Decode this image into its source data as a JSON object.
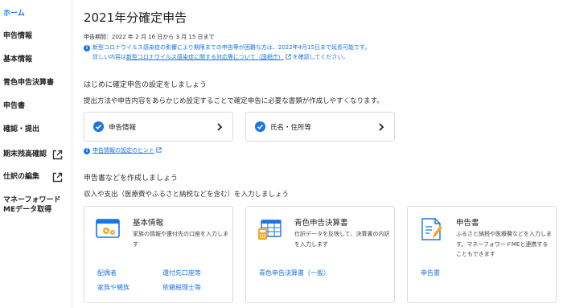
{
  "sidebar": {
    "items": [
      {
        "label": "ホーム",
        "active": true,
        "external": false
      },
      {
        "label": "申告情報",
        "active": false,
        "external": false
      },
      {
        "label": "基本情報",
        "active": false,
        "external": false
      },
      {
        "label": "青色申告決算書",
        "active": false,
        "external": false
      },
      {
        "label": "申告書",
        "active": false,
        "external": false
      },
      {
        "label": "確認・提出",
        "active": false,
        "external": false
      },
      {
        "label": "期末残高確認",
        "active": false,
        "external": true
      },
      {
        "label": "仕訳の編集",
        "active": false,
        "external": true
      },
      {
        "label": "マネーフォワード",
        "active": false,
        "external": false
      },
      {
        "label": "MEデータ取得",
        "active": false,
        "external": false
      }
    ]
  },
  "page": {
    "title": "2021年分確定申告",
    "period": "申告期間：2022 年 2 月 16 日から 3 月 15 日まで",
    "notice_line1": "新型コロナウイルス感染症の影響により期限までの申告等が困難な方は、2022年4月15日まで延長可能です。",
    "notice_line2_pre": "詳しい内容は",
    "notice_link": "新型コロナウイルス感染症に関する対応等について（国税庁）",
    "notice_line2_post": "を確認してください。"
  },
  "setup": {
    "heading": "はじめに確定申告の設定をしましょう",
    "description": "提出方法や申告内容をあらかじめ設定することで確定申告に必要な書類が作成しやすくなります。",
    "cards": [
      {
        "label": "申告情報"
      },
      {
        "label": "氏名・住所等"
      }
    ],
    "hint_link": "申告情報の設定のヒント"
  },
  "documents": {
    "heading": "申告書などを作成しましょう",
    "description": "収入や支出（医療費やふるさと納税などを含む）を入力しましょう",
    "cards": [
      {
        "title": "基本情報",
        "desc": "家族の情報や還付先の口座を入力します",
        "links": [
          "配偶者",
          "還付先口座等",
          "家族や親族",
          "依頼税理士等"
        ]
      },
      {
        "title": "青色申告決算書",
        "desc": "仕訳データを反映して、決算書の内訳を入力します",
        "links": [
          "青色申告決算書（一般）"
        ]
      },
      {
        "title": "申告書",
        "desc": "ふるさと納税や医療費などを入力します。マネーフォワードMEと連携することもできます",
        "links": [
          "申告書"
        ]
      }
    ]
  },
  "colors": {
    "accent": "#1a73e8",
    "icon_orange": "#f5a623"
  }
}
